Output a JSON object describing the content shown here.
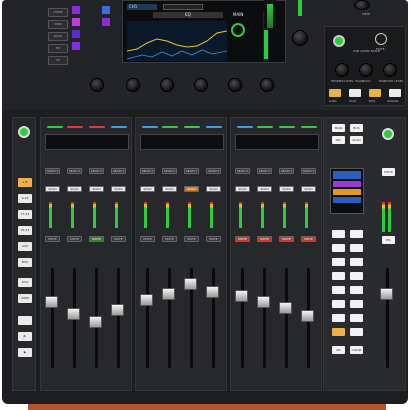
{
  "screen": {
    "eq_label": "EQ",
    "main_label": "MAIN",
    "ch_label": "CH1"
  },
  "top_right": {
    "view_label": "VIEW",
    "usb_label": "USB AUDIO PATCH",
    "mute_label": "MUTE",
    "knob_labels": [
      "PHONES LEVEL",
      "TALKBACK",
      "MONITOR LEVEL"
    ],
    "button_labels": [
      "GAIN",
      "TALK",
      "BUS",
      "ASSIGN"
    ]
  },
  "left_buttons": [
    "HOME",
    "VIEW",
    "RACK",
    "EQ",
    "FX"
  ],
  "layer_buttons": [
    "1-8",
    "9-16",
    "17-24",
    "25-32",
    "AUX",
    "BUS",
    "DCA",
    "USER"
  ],
  "strip_buttons": {
    "select": "SELECT",
    "solo": "SOLO",
    "mute": "MUTE"
  },
  "master": {
    "buttons": [
      "MAIN",
      "BUS",
      "SEL",
      "SOLO",
      "MUTE",
      "PFL",
      "AFL",
      "CLEAR"
    ]
  },
  "colors": {
    "panel": "#1d1e20",
    "wood": "#b5542c",
    "green_led": "#2ecc40",
    "mute_red": "#c0392b",
    "select_green": "#2e7d32",
    "solo_orange": "#d07a1e"
  }
}
